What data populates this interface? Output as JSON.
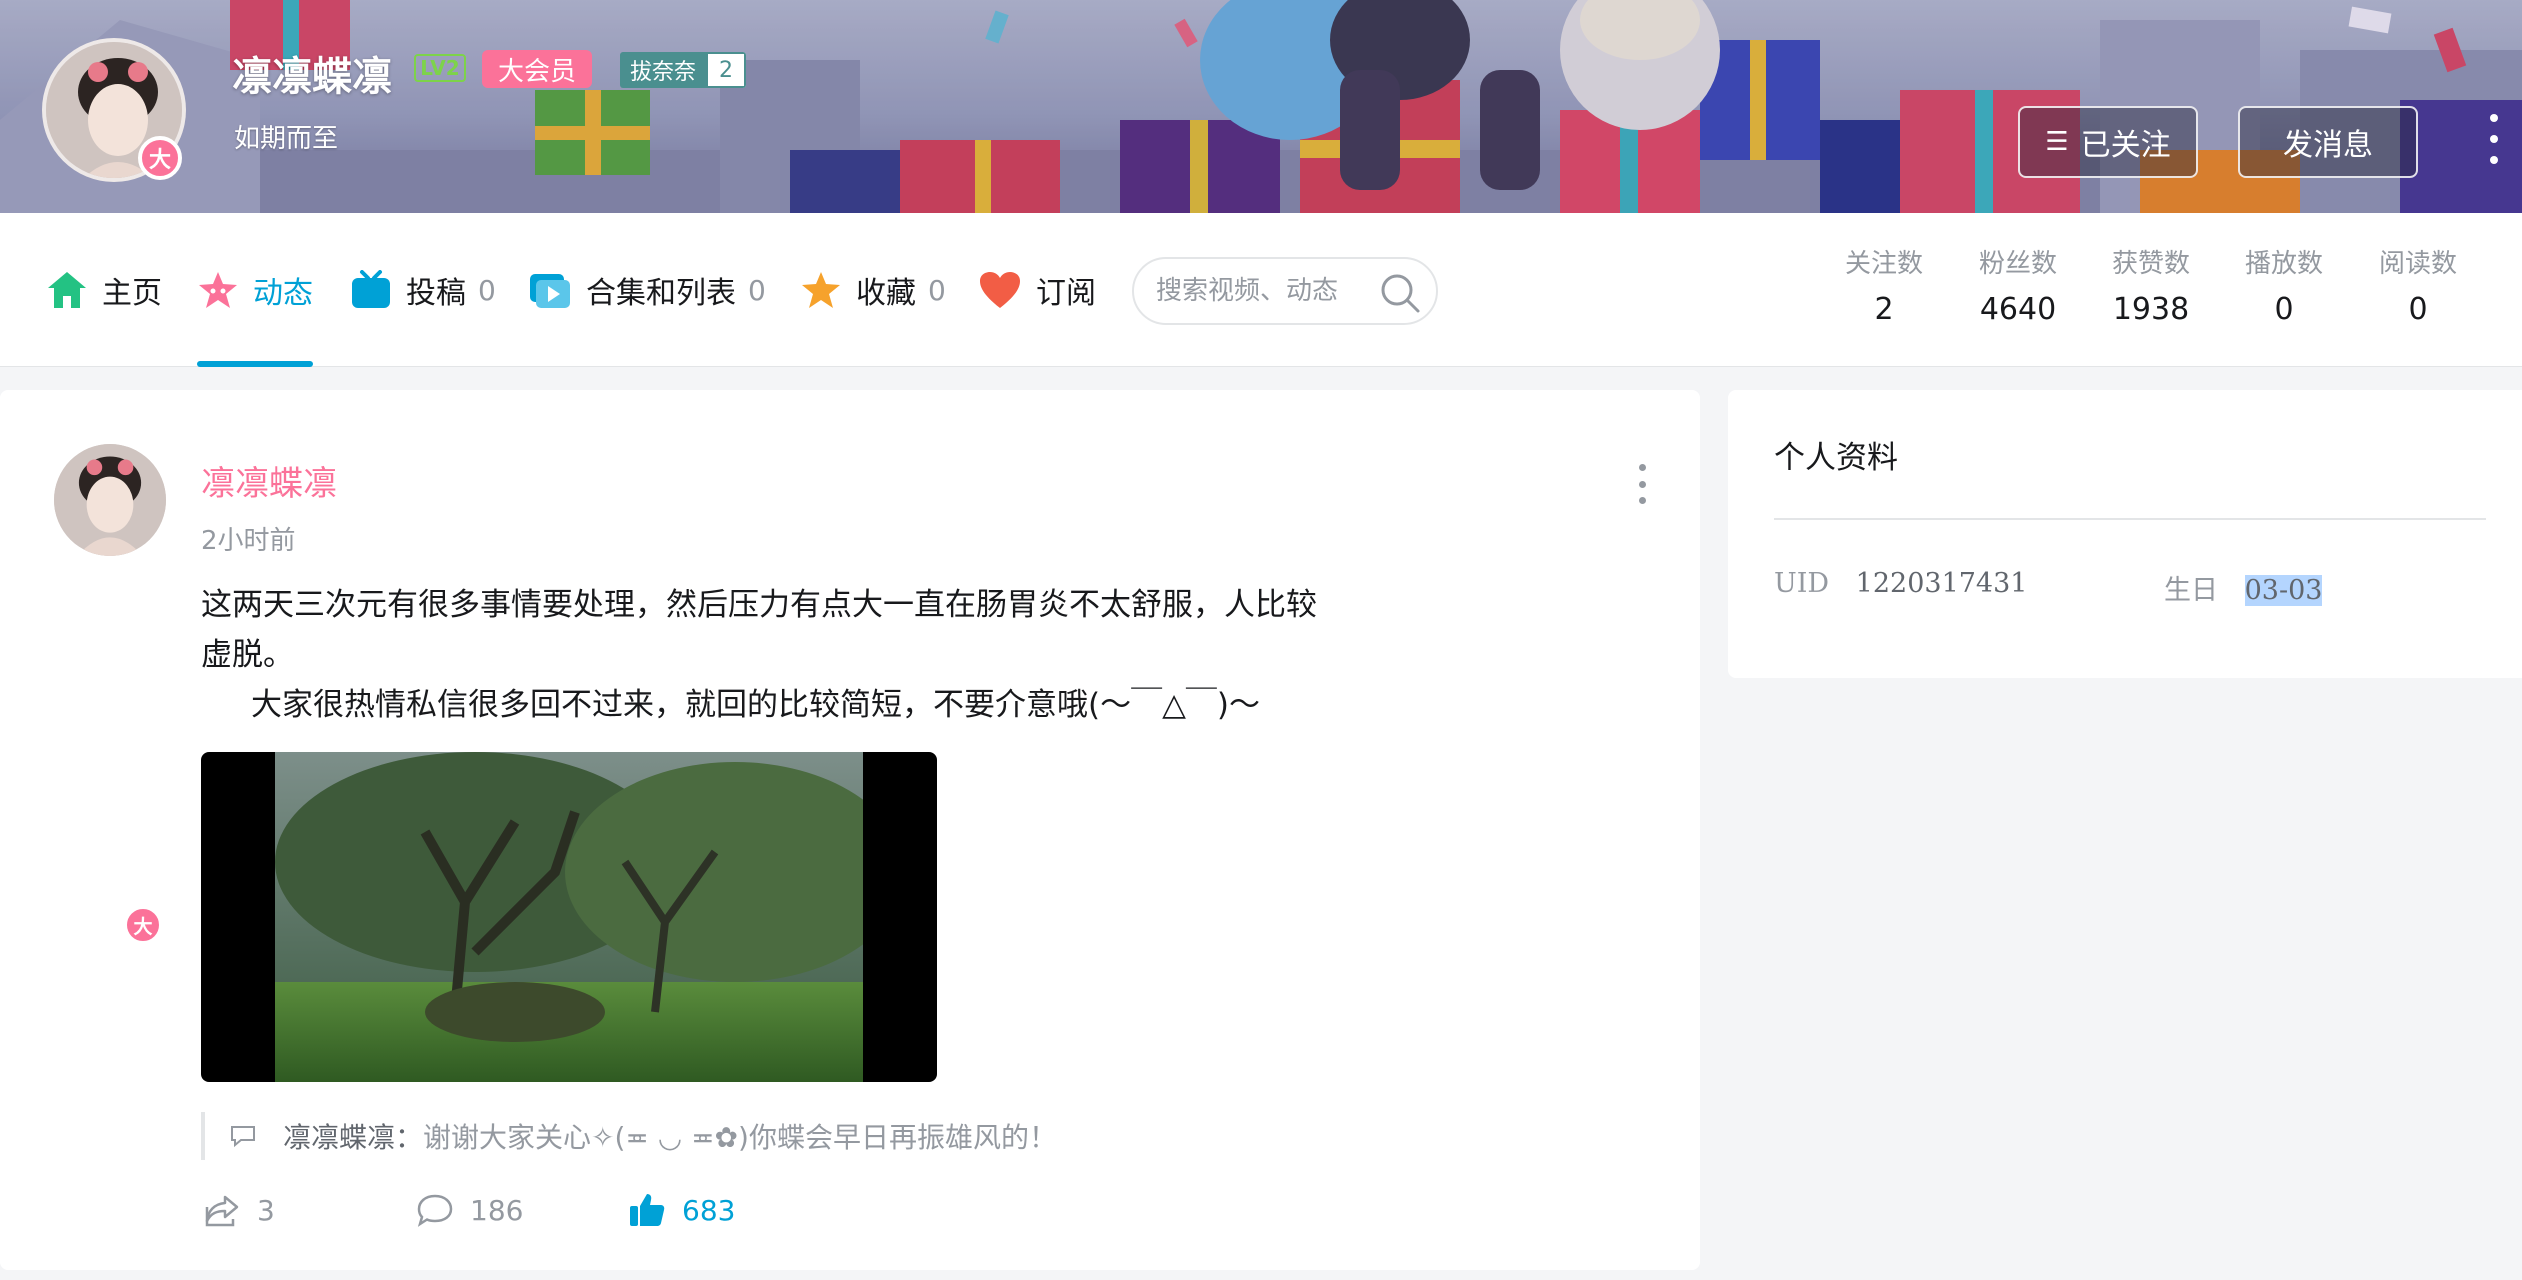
{
  "header": {
    "username": "凛凛蝶凛",
    "level_badge": "LV2",
    "vip_badge": "大会员",
    "medal_name": "拔奈奈",
    "medal_level": "2",
    "avatar_badge": "大",
    "signature": "如期而至",
    "followed_label": "已关注",
    "message_label": "发消息"
  },
  "nav": {
    "tabs": [
      {
        "label": "主页",
        "count": ""
      },
      {
        "label": "动态",
        "count": ""
      },
      {
        "label": "投稿",
        "count": "0"
      },
      {
        "label": "合集和列表",
        "count": "0"
      },
      {
        "label": "收藏",
        "count": "0"
      },
      {
        "label": "订阅",
        "count": ""
      }
    ],
    "active_tab": "动态",
    "search_placeholder": "搜索视频、动态",
    "stats": [
      {
        "label": "关注数",
        "value": "2"
      },
      {
        "label": "粉丝数",
        "value": "4640"
      },
      {
        "label": "获赞数",
        "value": "1938"
      },
      {
        "label": "播放数",
        "value": "0"
      },
      {
        "label": "阅读数",
        "value": "0"
      }
    ]
  },
  "post": {
    "author": "凛凛蝶凛",
    "avatar_badge": "大",
    "time": "2小时前",
    "lines": [
      "这两天三次元有很多事情要处理，然后压力有点大一直在肠胃炎不太舒服，人比较",
      "虚脱。",
      "大家很热情私信很多回不过来，就回的比较简短，不要介意哦(～￣△￣)～"
    ],
    "reply_author": "凛凛蝶凛：",
    "reply_text": "谢谢大家关心✧(≖ ◡ ≖✿)你蝶会早日再振雄风的！",
    "shares": "3",
    "comments": "186",
    "likes": "683"
  },
  "profile": {
    "title": "个人资料",
    "uid_label": "UID",
    "uid": "1220317431",
    "birthday_label": "生日",
    "birthday": "03-03"
  },
  "colors": {
    "accent": "#00a1d6",
    "pink": "#fb7299",
    "muted": "#9499a0"
  }
}
